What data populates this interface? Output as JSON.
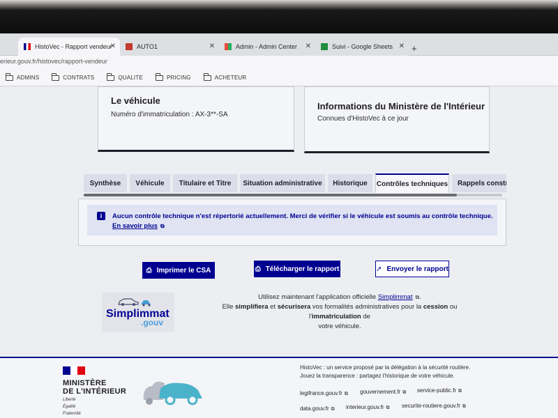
{
  "browser": {
    "tabs": [
      {
        "label": "HistoVec - Rapport vendeur",
        "active": true
      },
      {
        "label": "AUTO1",
        "active": false
      },
      {
        "label": "Admin - Admin Center",
        "active": false
      },
      {
        "label": "Suivi - Google Sheets",
        "active": false
      }
    ],
    "new_tab": "+",
    "url": "erieur.gouv.fr/histovec/rapport-vendeur",
    "bookmarks": [
      "ADMINS",
      "CONTRATS",
      "QUALITE",
      "PRICING",
      "ACHETEUR"
    ]
  },
  "cards": {
    "vehicule": {
      "title": "Le véhicule",
      "text": "Numéro d'immatriculation : AX-3**-SA"
    },
    "ministere": {
      "title": "Informations du Ministère de l'Intérieur",
      "text": "Connues d'HistoVec à ce jour"
    }
  },
  "report_tabs": [
    "Synthèse",
    "Véhicule",
    "Titulaire et Titre",
    "Situation administrative",
    "Historique",
    "Contrôles techniques",
    "Rappels constru"
  ],
  "active_tab": "Contrôles techniques",
  "alert": {
    "text": "Aucun contrôle technique n'est répertorié actuellement. Merci de vérifier si le véhicule est soumis au contrôle technique.",
    "link": "En savoir plus"
  },
  "actions": {
    "print": "Imprimer le CSA",
    "download": "Télécharger le rapport",
    "send": "Envoyer le rapport"
  },
  "simplimmat": {
    "logo_main": "Simplimmat",
    "logo_sub": ".gouv",
    "line1_pre": "Utilisez maintenant l'application officielle ",
    "line1_link": "Simplimmat",
    "line1_post": ".",
    "line2_a": "Elle ",
    "line2_b": "simplifiera",
    "line2_c": " et ",
    "line2_d": "sécurisera",
    "line2_e": " vos formalités administratives pour la ",
    "line2_f": "cession",
    "line2_g": " ou l'",
    "line2_h": "immatriculation",
    "line2_i": " de",
    "line3": "votre véhicule."
  },
  "footer": {
    "ministere": [
      "MINISTÈRE",
      "DE L'INTÉRIEUR"
    ],
    "motto": [
      "Liberté",
      "Égalité",
      "Fraternité"
    ],
    "desc1": "HistoVec : un service proposé par la délégation à la sécurité routière.",
    "desc2": "Jouez la transparence : partagez l'historique de votre véhicule.",
    "links": [
      "legifrance.gouv.fr",
      "gouvernement.fr",
      "service-public.fr",
      "data.gouv.fr",
      "interieur.gouv.fr",
      "securite-routiere.gouv.fr"
    ]
  },
  "colors": {
    "primary": "#000091",
    "flag_blue": "#000091",
    "flag_red": "#e1000f",
    "accent": "#4b9bd6"
  }
}
